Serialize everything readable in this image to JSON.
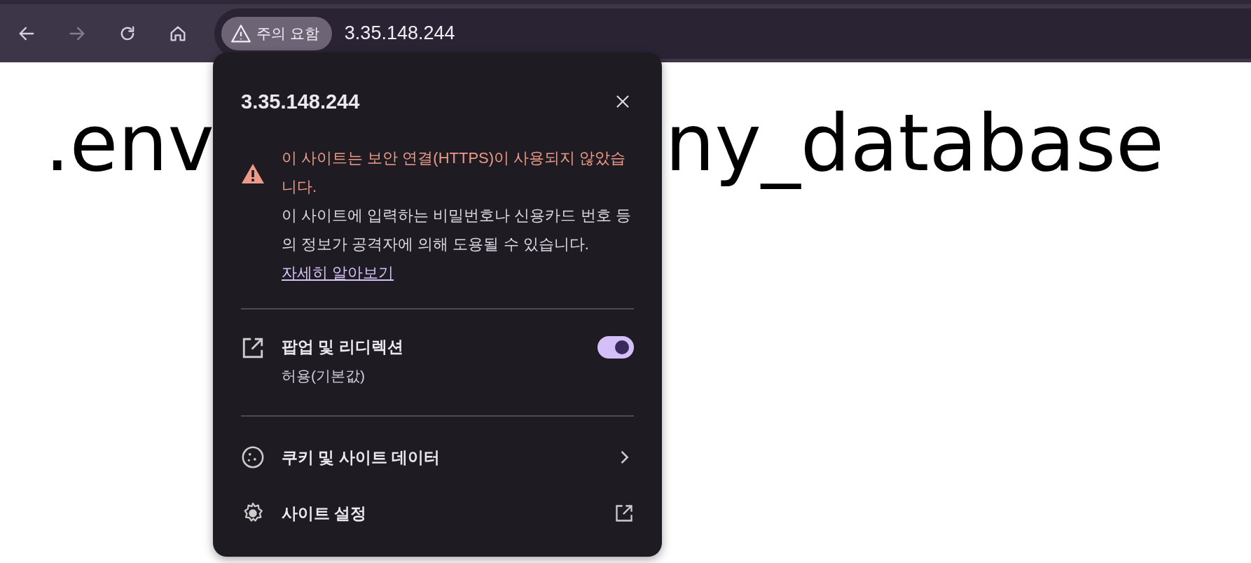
{
  "toolbar": {
    "nav_buttons": [
      {
        "kind": "back",
        "disabled": false
      },
      {
        "kind": "forward",
        "disabled": true
      },
      {
        "kind": "reload",
        "disabled": false
      },
      {
        "kind": "home",
        "disabled": false
      }
    ],
    "security_chip": "주의 요함",
    "address": "3.35.148.244"
  },
  "page": {
    "heading_left": ".env",
    "heading_right": "ny_database"
  },
  "popup": {
    "title": "3.35.148.244",
    "warning": {
      "title": "이 사이트는 보안 연결(HTTPS)이 사용되지 않았습니다.",
      "body": "이 사이트에 입력하는 비밀번호나 신용카드 번호 등의 정보가 공격자에 의해 도용될 수 있습니다.",
      "link": "자세히 알아보기"
    },
    "permissions": [
      {
        "label": "팝업 및 리디렉션",
        "value": "허용(기본값)",
        "on": true
      }
    ],
    "links": [
      {
        "kind": "cookies",
        "label": "쿠키 및 사이트 데이터"
      },
      {
        "kind": "settings",
        "label": "사이트 설정"
      }
    ]
  }
}
